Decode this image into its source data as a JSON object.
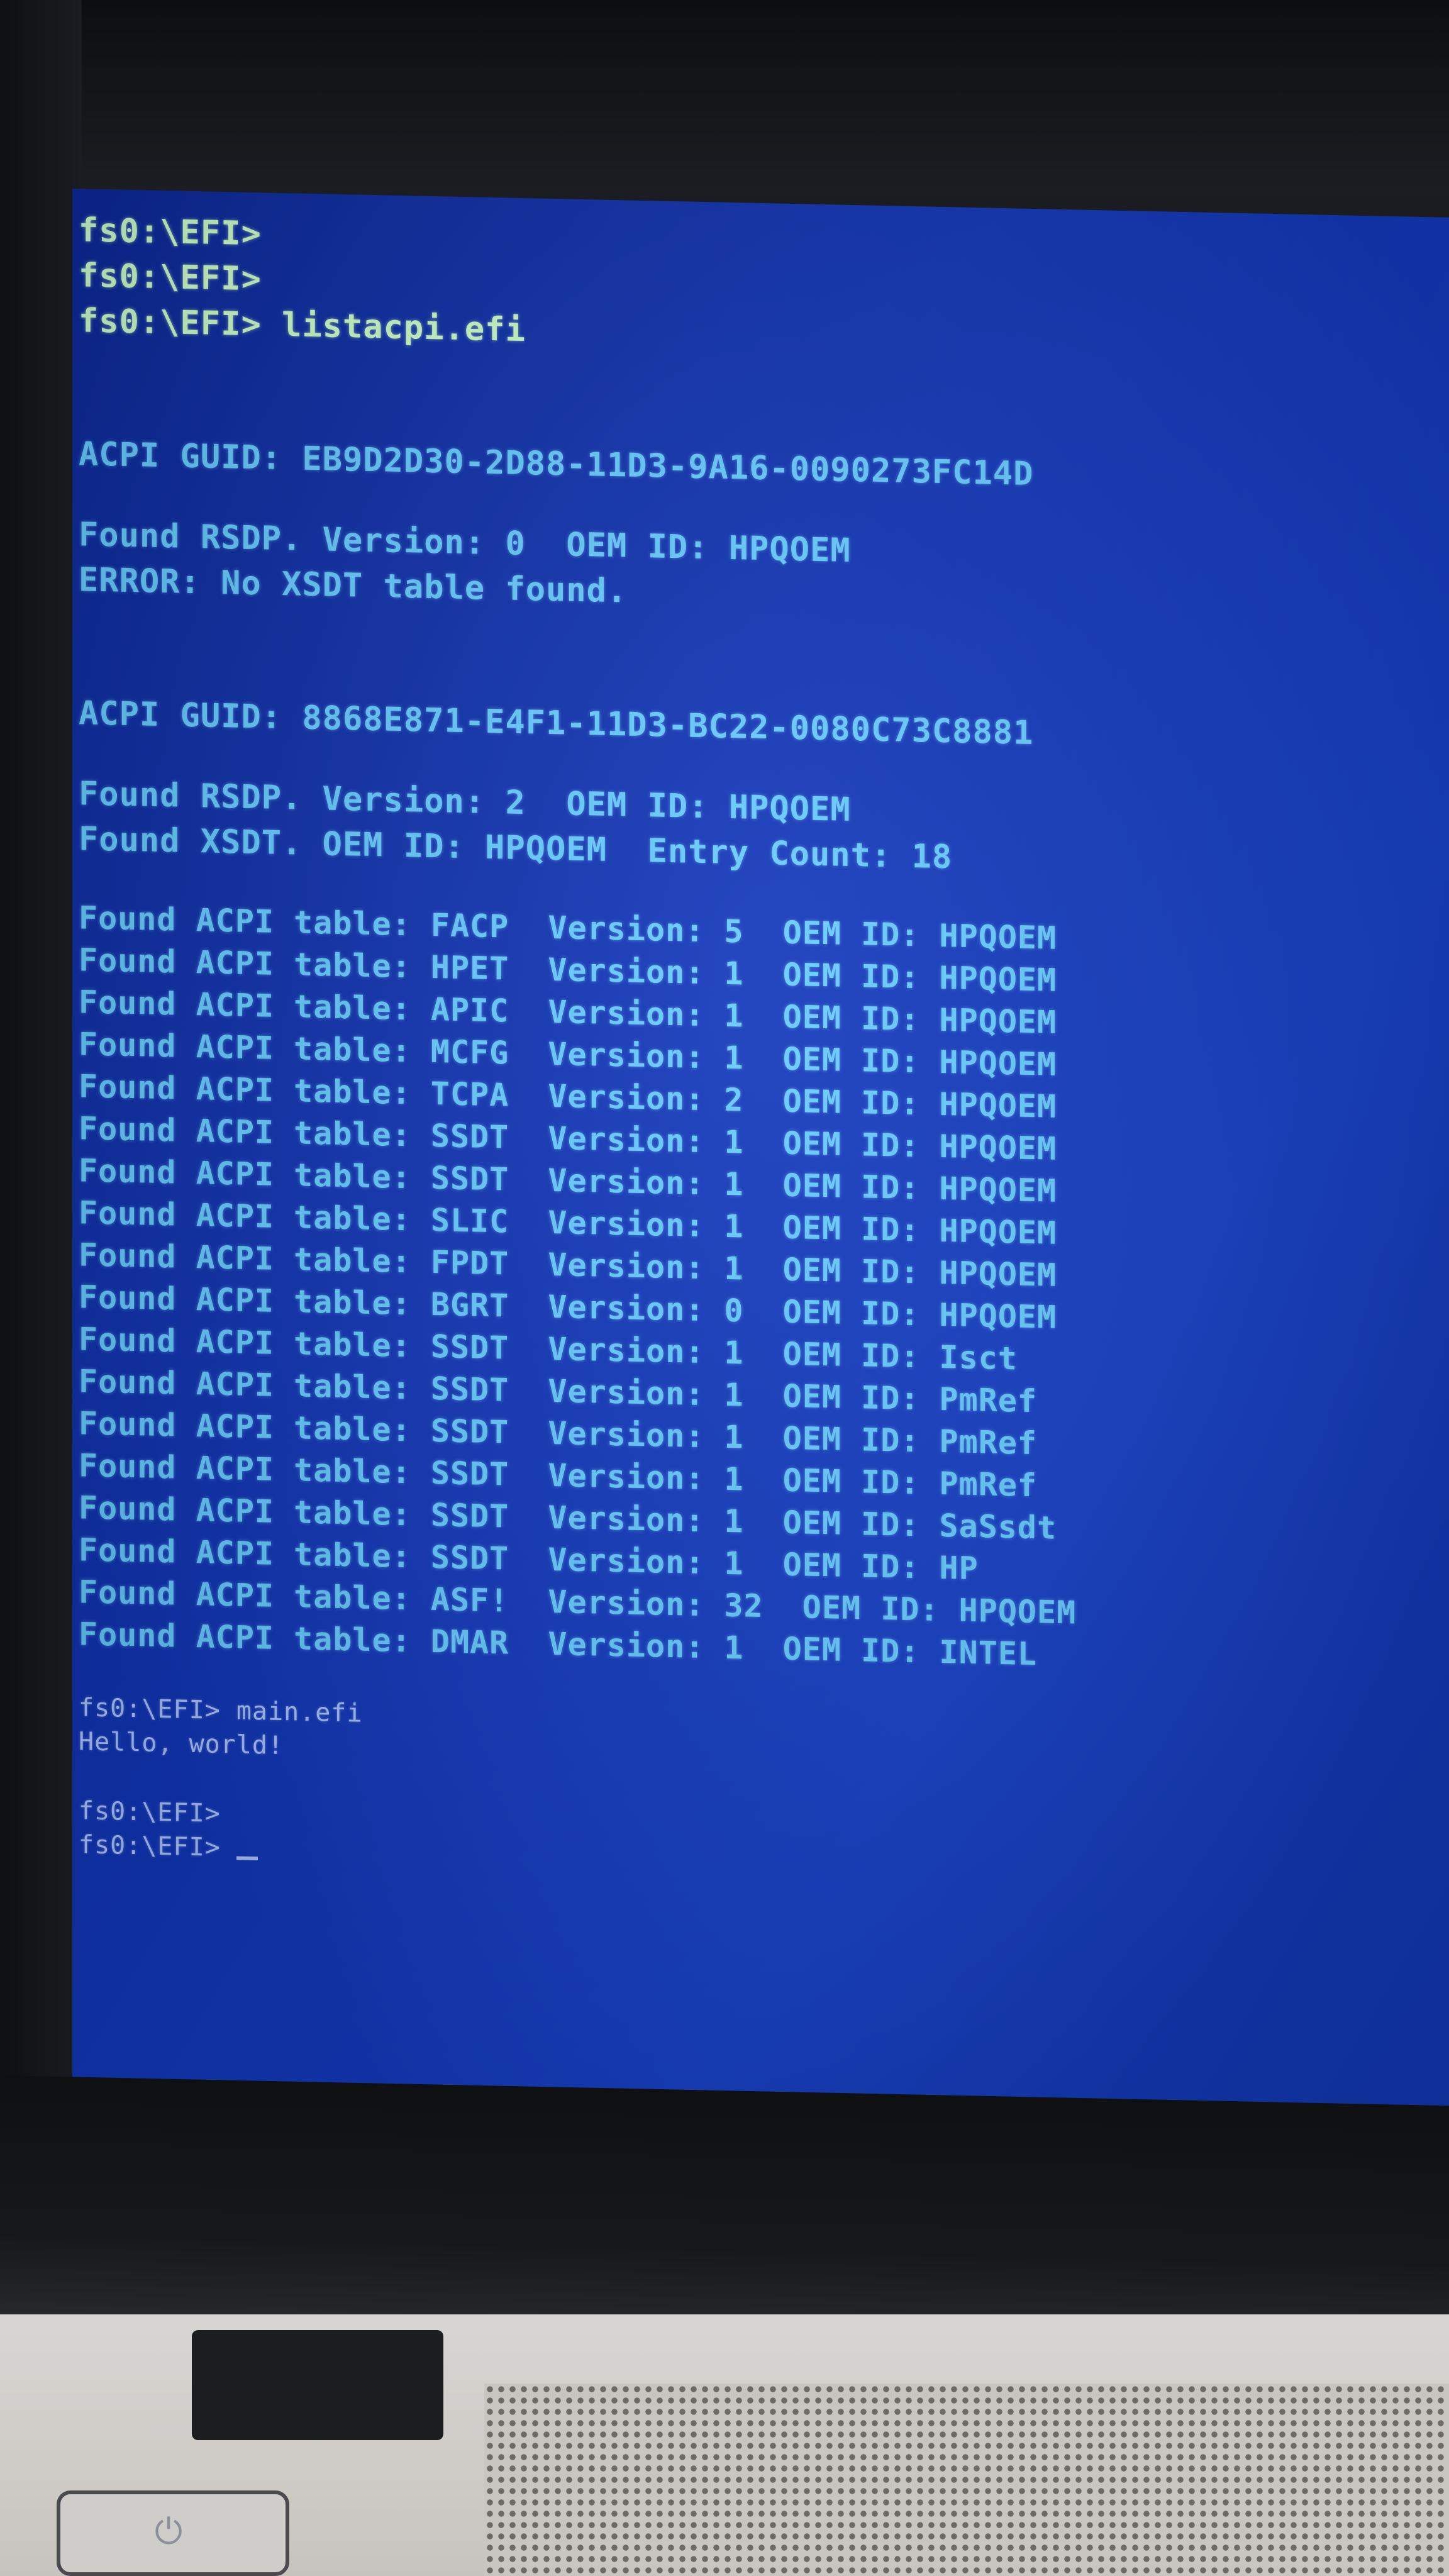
{
  "terminal": {
    "lines": [
      {
        "text": "fs0:\\EFI>"
      },
      {
        "text": "fs0:\\EFI>"
      },
      {
        "text": "fs0:\\EFI> listacpi.efi"
      },
      {
        "text": "ACPI GUID: EB9D2D30-2D88-11D3-9A16-0090273FC14D"
      },
      {
        "text": "Found RSDP. Version: 0  OEM ID: HPQOEM"
      },
      {
        "text": "ERROR: No XSDT table found."
      },
      {
        "text": "ACPI GUID: 8868E871-E4F1-11D3-BC22-0080C73C8881"
      },
      {
        "text": "Found RSDP. Version: 2  OEM ID: HPQOEM"
      },
      {
        "text": "Found XSDT. OEM ID: HPQOEM  Entry Count: 18"
      }
    ],
    "tables": [
      {
        "text": "Found ACPI table: FACP  Version: 5  OEM ID: HPQOEM"
      },
      {
        "text": "Found ACPI table: HPET  Version: 1  OEM ID: HPQOEM"
      },
      {
        "text": "Found ACPI table: APIC  Version: 1  OEM ID: HPQOEM"
      },
      {
        "text": "Found ACPI table: MCFG  Version: 1  OEM ID: HPQOEM"
      },
      {
        "text": "Found ACPI table: TCPA  Version: 2  OEM ID: HPQOEM"
      },
      {
        "text": "Found ACPI table: SSDT  Version: 1  OEM ID: HPQOEM"
      },
      {
        "text": "Found ACPI table: SSDT  Version: 1  OEM ID: HPQOEM"
      },
      {
        "text": "Found ACPI table: SLIC  Version: 1  OEM ID: HPQOEM"
      },
      {
        "text": "Found ACPI table: FPDT  Version: 1  OEM ID: HPQOEM"
      },
      {
        "text": "Found ACPI table: BGRT  Version: 0  OEM ID: HPQOEM"
      },
      {
        "text": "Found ACPI table: SSDT  Version: 1  OEM ID: Isct"
      },
      {
        "text": "Found ACPI table: SSDT  Version: 1  OEM ID: PmRef"
      },
      {
        "text": "Found ACPI table: SSDT  Version: 1  OEM ID: PmRef"
      },
      {
        "text": "Found ACPI table: SSDT  Version: 1  OEM ID: PmRef"
      },
      {
        "text": "Found ACPI table: SSDT  Version: 1  OEM ID: SaSsdt"
      },
      {
        "text": "Found ACPI table: SSDT  Version: 1  OEM ID: HP"
      },
      {
        "text": "Found ACPI table: ASF!  Version: 32  OEM ID: HPQOEM"
      },
      {
        "text": "Found ACPI table: DMAR  Version: 1  OEM ID: INTEL"
      }
    ],
    "tail": [
      {
        "text": "fs0:\\EFI> main.efi"
      },
      {
        "text": "Hello, world!"
      },
      {
        "text": "fs0:\\EFI>"
      },
      {
        "text": "fs0:\\EFI> "
      }
    ]
  },
  "colors": {
    "screen_bg": "#1236b8",
    "text": "#66ccff",
    "prompt_text": "#ccffcc",
    "small_text": "#a9c4ff"
  }
}
